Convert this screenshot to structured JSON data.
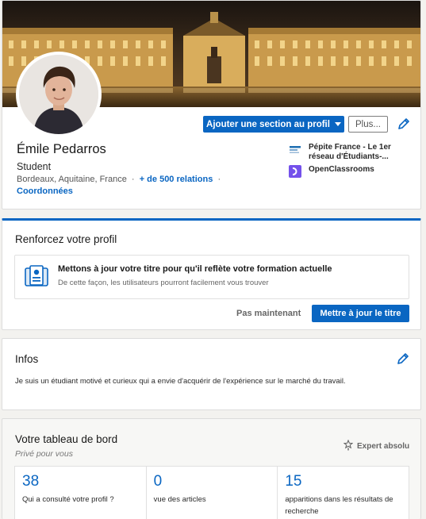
{
  "profile": {
    "name": "Émile Pedarros",
    "headline": "Student",
    "location": "Bordeaux, Aquitaine, France",
    "connections": "+ de 500 relations",
    "contact_info": "Coordonnées",
    "add_section_button": "Ajouter une section au profil",
    "more_button": "Plus...",
    "organizations": [
      {
        "name": "Pépite France - Le 1er réseau d'Étudiants-...",
        "icon": "pepite-logo"
      },
      {
        "name": "OpenClassrooms",
        "icon": "openclassrooms-logo"
      }
    ]
  },
  "strengthen": {
    "title": "Renforcez votre profil",
    "suggestion_title": "Mettons à jour votre titre pour qu'il reflète votre formation actuelle",
    "suggestion_text": "De cette façon, les utilisateurs pourront facilement vous trouver",
    "later_button": "Pas maintenant",
    "update_button": "Mettre à jour le titre",
    "icon": "id-card-icon"
  },
  "about": {
    "title": "Infos",
    "text": "Je suis un étudiant motivé et curieux qui a envie d'acquérir de l'expérience sur le marché du travail."
  },
  "dashboard": {
    "title": "Votre tableau de bord",
    "subtitle": "Privé pour vous",
    "badge": "Expert absolu",
    "stats": [
      {
        "value": "38",
        "label": "Qui a consulté votre profil ?"
      },
      {
        "value": "0",
        "label": "vue des articles"
      },
      {
        "value": "15",
        "label": "apparitions dans les résultats de recherche"
      }
    ]
  },
  "colors": {
    "primary": "#0a66c2",
    "background": "#f3f2ef",
    "openclassrooms": "#7451eb"
  }
}
